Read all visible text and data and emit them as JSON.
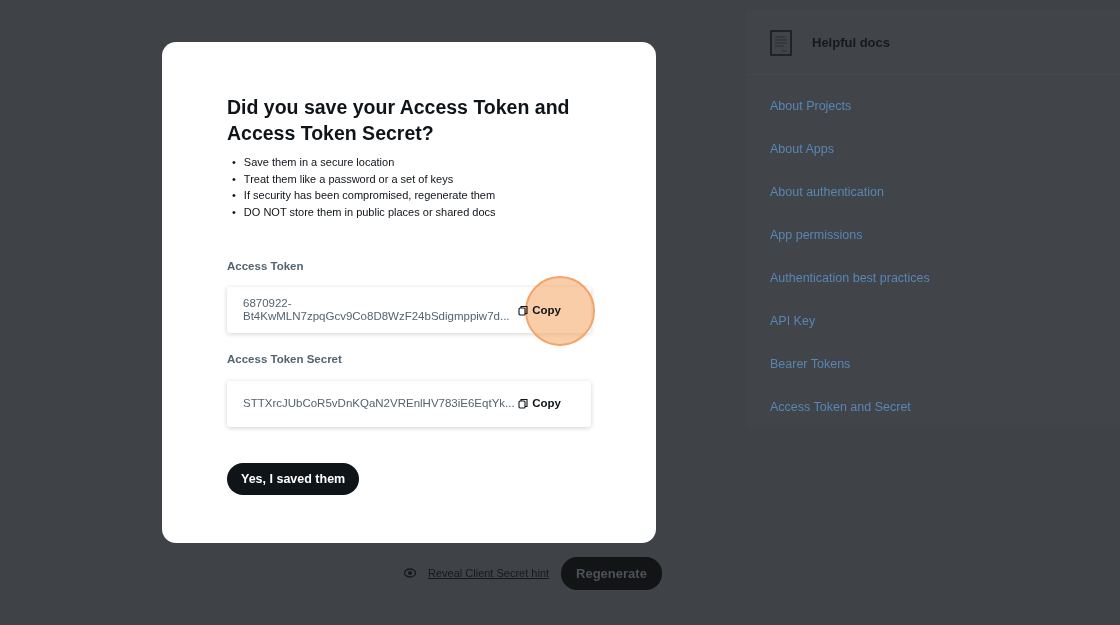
{
  "modal": {
    "title": "Did you save your Access Token and Access Token Secret?",
    "tips": [
      {
        "bullet": "•",
        "text": "Save them in a secure location"
      },
      {
        "bullet": "•",
        "text": "Treat them like a password or a set of keys"
      },
      {
        "bullet": "•",
        "text": "If security has been compromised, regenerate them"
      },
      {
        "bullet": "•",
        "text": "DO NOT store them in public places or shared docs"
      }
    ],
    "fields": [
      {
        "label": "Access Token",
        "value": "6870922-\nBt4KwMLN7zpqGcv9Co8D8WzF24bSdigmppiw7d...",
        "copy_label": "Copy",
        "highlighted": true
      },
      {
        "label": "Access Token Secret",
        "value": "STTXrcJUbCoR5vDnKQaN2VREnlHV783iE6EqtYk...",
        "copy_label": "Copy",
        "highlighted": false
      }
    ],
    "confirm_button": "Yes, I saved them"
  },
  "background": {
    "reveal_link": "Reveal Client Secret hint",
    "regenerate_button": "Regenerate",
    "sidebar": {
      "title": "Helpful docs",
      "links": [
        "About Projects",
        "About Apps",
        "About authentication",
        "App permissions",
        "Authentication best practices",
        "API Key",
        "Bearer Tokens",
        "Access Token and Secret"
      ]
    }
  }
}
